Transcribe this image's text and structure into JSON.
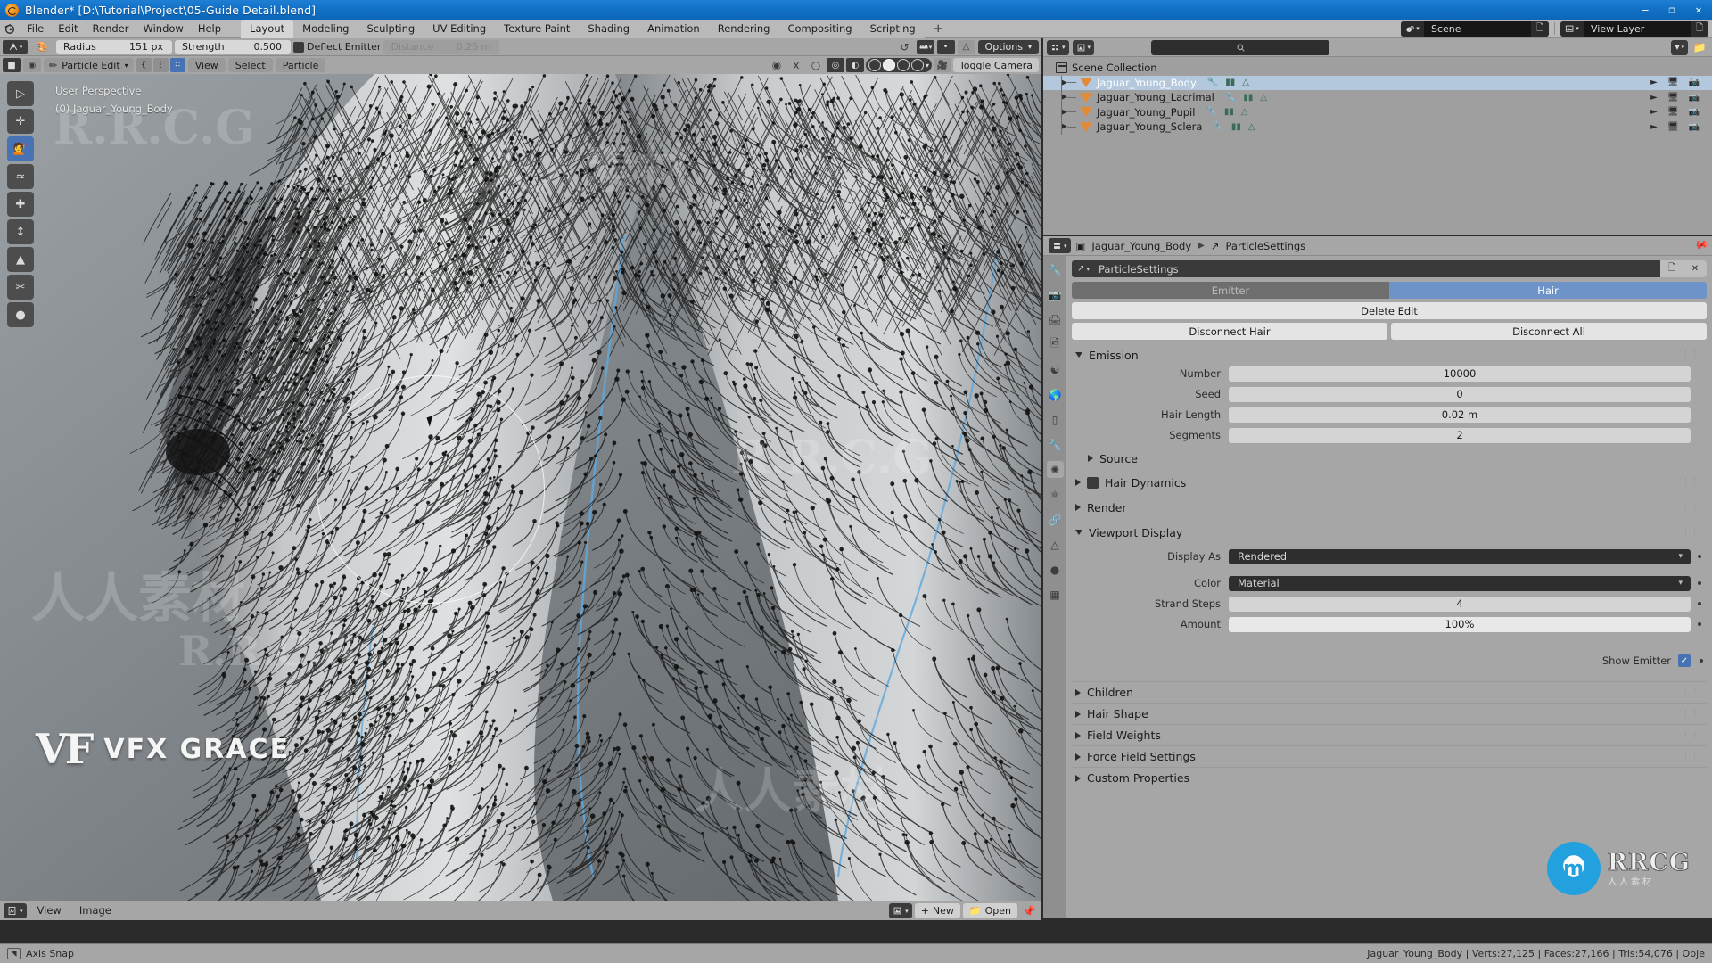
{
  "window": {
    "title": "Blender* [D:\\Tutorial\\Project\\05-Guide Detail.blend]",
    "minimize": "—",
    "maximize": "❐",
    "close": "✕"
  },
  "topbar": {
    "menus": [
      "File",
      "Edit",
      "Render",
      "Window",
      "Help"
    ],
    "workspace_tabs": [
      "Layout",
      "Modeling",
      "Sculpting",
      "UV Editing",
      "Texture Paint",
      "Shading",
      "Animation",
      "Rendering",
      "Compositing",
      "Scripting"
    ],
    "active_tab": "Layout",
    "add_tab": "+",
    "scene_name": "Scene",
    "view_layer_name": "View Layer"
  },
  "tool_settings": {
    "radius_label": "Radius",
    "radius_value": "151 px",
    "strength_label": "Strength",
    "strength_value": "0.500",
    "deflect_emitter_label": "Deflect Emitter",
    "distance_label": "Distance",
    "distance_value": "0.25 m",
    "options_label": "Options"
  },
  "viewport_header": {
    "mode": "Particle Edit",
    "menus": [
      "View",
      "Select",
      "Particle"
    ],
    "toggle_camera": "Toggle Camera"
  },
  "viewport": {
    "perspective_text": "User Perspective",
    "object_text": "(0) Jaguar_Young_Body",
    "watermark_vfx_v": "VF",
    "watermark_vfx_text": "VFX GRACE"
  },
  "image_editor_footer": {
    "menus": [
      "View",
      "Image"
    ],
    "new_label": "New",
    "open_label": "Open"
  },
  "outliner": {
    "root": "Scene Collection",
    "items": [
      {
        "name": "Jaguar_Young_Body",
        "selected": true
      },
      {
        "name": "Jaguar_Young_Lacrimal",
        "selected": false
      },
      {
        "name": "Jaguar_Young_Pupil",
        "selected": false
      },
      {
        "name": "Jaguar_Young_Sclera",
        "selected": false
      }
    ]
  },
  "properties": {
    "breadcrumb_object": "Jaguar_Young_Body",
    "breadcrumb_data": "ParticleSettings",
    "datablock_name": "ParticleSettings",
    "type_emitter": "Emitter",
    "type_hair": "Hair",
    "active_type": "Hair",
    "delete_edit": "Delete Edit",
    "disconnect_hair": "Disconnect Hair",
    "disconnect_all": "Disconnect All",
    "emission": {
      "title": "Emission",
      "rows": [
        {
          "label": "Number",
          "value": "10000"
        },
        {
          "label": "Seed",
          "value": "0"
        },
        {
          "label": "Hair Length",
          "value": "0.02 m"
        },
        {
          "label": "Segments",
          "value": "2"
        }
      ],
      "source_label": "Source"
    },
    "hair_dynamics": "Hair Dynamics",
    "render": "Render",
    "viewport_display": {
      "title": "Viewport Display",
      "display_as_label": "Display As",
      "display_as_value": "Rendered",
      "color_label": "Color",
      "color_value": "Material",
      "strand_steps_label": "Strand Steps",
      "strand_steps_value": "4",
      "amount_label": "Amount",
      "amount_value": "100%",
      "show_emitter_label": "Show Emitter"
    },
    "collapsed_panels": [
      "Children",
      "Hair Shape",
      "Field Weights",
      "Force Field Settings",
      "Custom Properties"
    ]
  },
  "statusbar": {
    "hint": "Axis Snap",
    "stats": "Jaguar_Young_Body | Verts:27,125 | Faces:27,166 | Tris:54,076 | Obje"
  },
  "branding": {
    "rrcg_main": "RRCG",
    "rrcg_sub": "人人素材"
  },
  "colors": {
    "accent_blue": "#4772b3",
    "header_gray": "#a6a6a6",
    "title_blue": "#1271c6",
    "outliner_orange": "#e08b3a"
  }
}
